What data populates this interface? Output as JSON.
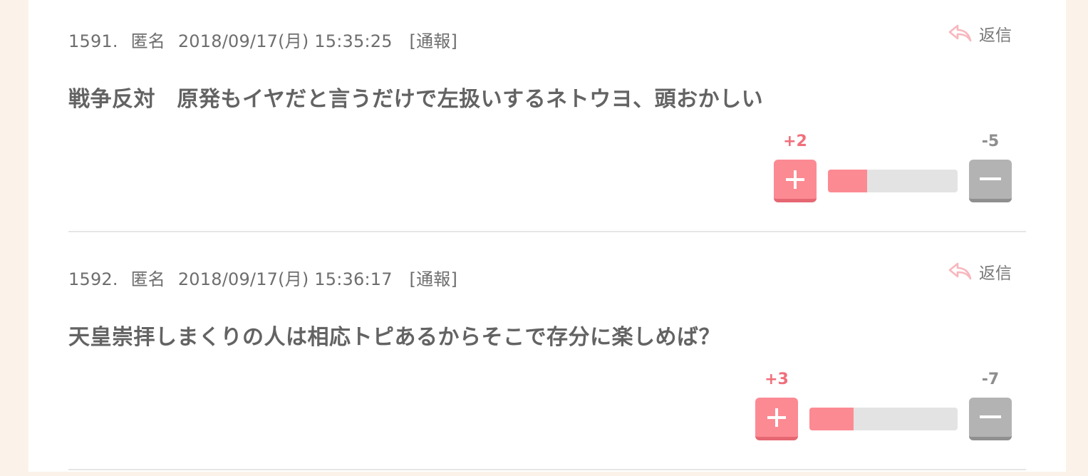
{
  "reply_label": "返信",
  "comments": [
    {
      "number": "1591.",
      "author": "匿名",
      "datetime": "2018/09/17(月) 15:35:25",
      "report_label": "[通報]",
      "body": "戦争反対　原発もイヤだと言うだけで左扱いするネトウヨ、頭おかしい",
      "plus": "+2",
      "minus": "-5",
      "plus_ratio": 0.3
    },
    {
      "number": "1592.",
      "author": "匿名",
      "datetime": "2018/09/17(月) 15:36:17",
      "report_label": "[通報]",
      "body": "天皇崇拝しまくりの人は相応トピあるからそこで存分に楽しめば？",
      "plus": "+3",
      "minus": "-7",
      "plus_ratio": 0.3
    }
  ],
  "colors": {
    "page_bg": "#fbf3ea",
    "plus": "#fc8a93",
    "plus_text": "#f06f7b",
    "minus": "#b3b3b3",
    "bar_bg": "#e3e3e3",
    "reply_icon": "#f7b7bd"
  },
  "icons": {
    "reply": "reply-arrow-icon",
    "plus": "plus-icon",
    "minus": "minus-icon"
  }
}
